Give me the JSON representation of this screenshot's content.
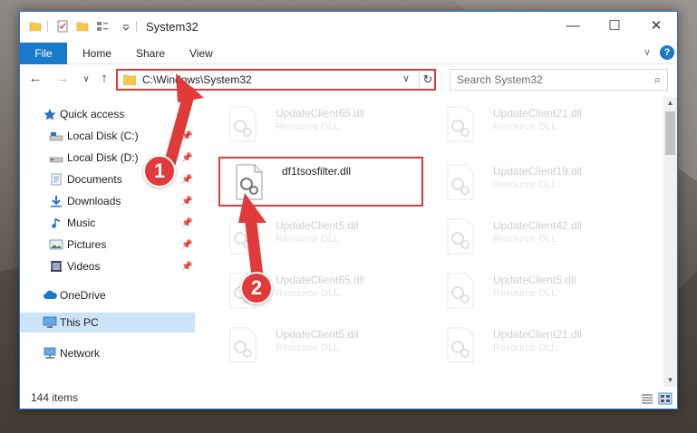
{
  "window": {
    "title": "System32",
    "minimize_glyph": "—",
    "maximize_glyph": "☐",
    "close_glyph": "✕"
  },
  "ribbon": {
    "tabs": [
      "File",
      "Home",
      "Share",
      "View"
    ],
    "collapse_glyph": "∨",
    "help_glyph": "?"
  },
  "nav": {
    "back_glyph": "←",
    "forward_glyph": "→",
    "recent_glyph": "∨",
    "up_glyph": "↑",
    "address": "C:\\Windows\\System32",
    "address_dropdown_glyph": "∨",
    "refresh_glyph": "↻",
    "search_placeholder": "Search System32",
    "search_glyph": "⌕"
  },
  "sidebar": {
    "items": [
      {
        "label": "Quick access",
        "icon": "star-icon",
        "pinned": false
      },
      {
        "label": "Local Disk (C:)",
        "icon": "drive-icon",
        "pinned": true
      },
      {
        "label": "Local Disk (D:)",
        "icon": "drive-icon",
        "pinned": true
      },
      {
        "label": "Documents",
        "icon": "documents-icon",
        "pinned": true
      },
      {
        "label": "Downloads",
        "icon": "download-icon",
        "pinned": true
      },
      {
        "label": "Music",
        "icon": "music-icon",
        "pinned": true
      },
      {
        "label": "Pictures",
        "icon": "pictures-icon",
        "pinned": true
      },
      {
        "label": "Videos",
        "icon": "videos-icon",
        "pinned": true
      },
      {
        "label": "OneDrive",
        "icon": "cloud-icon",
        "pinned": false
      },
      {
        "label": "This PC",
        "icon": "computer-icon",
        "pinned": false,
        "selected": true
      },
      {
        "label": "Network",
        "icon": "network-icon",
        "pinned": false
      }
    ],
    "pin_glyph": "📌"
  },
  "files": [
    {
      "name": "UpdateClient65.dll",
      "type": "Resource DLL",
      "faded": true
    },
    {
      "name": "UpdateClient21.dll",
      "type": "Resource DLL",
      "faded": true
    },
    {
      "name": "df1tsosfilter.dll",
      "type": "",
      "faded": false
    },
    {
      "name": "UpdateClient19.dll",
      "type": "Resource DLL",
      "faded": true
    },
    {
      "name": "UpdateClient5.dll",
      "type": "Resource DLL",
      "faded": true
    },
    {
      "name": "UpdateClient42.dll",
      "type": "Resource DLL",
      "faded": true
    },
    {
      "name": "UpdateClient65.dll",
      "type": "Resource DLL",
      "faded": true
    },
    {
      "name": "UpdateClient5.dll",
      "type": "Resource DLL",
      "faded": true
    },
    {
      "name": "UpdateClient5.dll",
      "type": "Resource DLL",
      "faded": true
    },
    {
      "name": "UpdateClient21.dll",
      "type": "Resource DLL",
      "faded": true
    }
  ],
  "status": {
    "item_count": "144 items"
  },
  "annotations": {
    "step1": "1",
    "step2": "2"
  },
  "colors": {
    "accent": "#1979ca",
    "highlight": "#e03a3a",
    "selection": "#cce4f7"
  }
}
